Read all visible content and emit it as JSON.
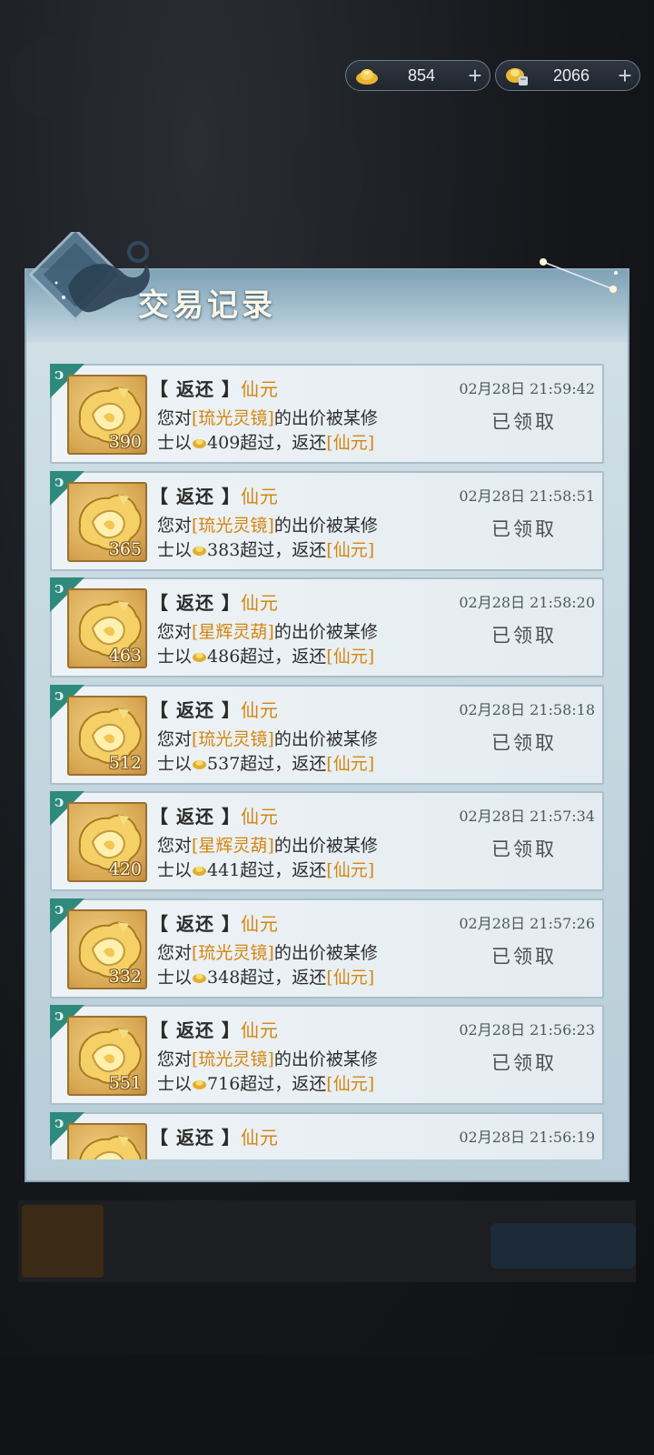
{
  "currency": [
    {
      "icon": "gold-ingot-icon",
      "value": "854"
    },
    {
      "icon": "gold-pouch-icon",
      "value": "2066"
    }
  ],
  "panel": {
    "title": "交易记录"
  },
  "records": [
    {
      "qty": "390",
      "tag": "【 返还 】",
      "currency_name": "仙元",
      "time": "02月28日  21:59:42",
      "line1_prefix": "您对",
      "item": "[琉光灵镜]",
      "line1_suffix": "的出价被某修",
      "line2_prefix": "士以",
      "bid": "409",
      "line2_mid": "超过，返还",
      "refund": "[仙元]",
      "status": "已领取"
    },
    {
      "qty": "365",
      "tag": "【 返还 】",
      "currency_name": "仙元",
      "time": "02月28日  21:58:51",
      "line1_prefix": "您对",
      "item": "[琉光灵镜]",
      "line1_suffix": "的出价被某修",
      "line2_prefix": "士以",
      "bid": "383",
      "line2_mid": "超过，返还",
      "refund": "[仙元]",
      "status": "已领取"
    },
    {
      "qty": "463",
      "tag": "【 返还 】",
      "currency_name": "仙元",
      "time": "02月28日  21:58:20",
      "line1_prefix": "您对",
      "item": "[星辉灵葫]",
      "line1_suffix": "的出价被某修",
      "line2_prefix": "士以",
      "bid": "486",
      "line2_mid": "超过，返还",
      "refund": "[仙元]",
      "status": "已领取"
    },
    {
      "qty": "512",
      "tag": "【 返还 】",
      "currency_name": "仙元",
      "time": "02月28日  21:58:18",
      "line1_prefix": "您对",
      "item": "[琉光灵镜]",
      "line1_suffix": "的出价被某修",
      "line2_prefix": "士以",
      "bid": "537",
      "line2_mid": "超过，返还",
      "refund": "[仙元]",
      "status": "已领取"
    },
    {
      "qty": "420",
      "tag": "【 返还 】",
      "currency_name": "仙元",
      "time": "02月28日  21:57:34",
      "line1_prefix": "您对",
      "item": "[星辉灵葫]",
      "line1_suffix": "的出价被某修",
      "line2_prefix": "士以",
      "bid": "441",
      "line2_mid": "超过，返还",
      "refund": "[仙元]",
      "status": "已领取"
    },
    {
      "qty": "332",
      "tag": "【 返还 】",
      "currency_name": "仙元",
      "time": "02月28日  21:57:26",
      "line1_prefix": "您对",
      "item": "[琉光灵镜]",
      "line1_suffix": "的出价被某修",
      "line2_prefix": "士以",
      "bid": "348",
      "line2_mid": "超过，返还",
      "refund": "[仙元]",
      "status": "已领取"
    },
    {
      "qty": "551",
      "tag": "【 返还 】",
      "currency_name": "仙元",
      "time": "02月28日  21:56:23",
      "line1_prefix": "您对",
      "item": "[琉光灵镜]",
      "line1_suffix": "的出价被某修",
      "line2_prefix": "士以",
      "bid": "716",
      "line2_mid": "超过，返还",
      "refund": "[仙元]",
      "status": "已领取"
    },
    {
      "qty": "",
      "tag": "【 返还 】",
      "currency_name": "仙元",
      "time": "02月28日  21:56:19",
      "line1_prefix": "",
      "item": "",
      "line1_suffix": "",
      "line2_prefix": "",
      "bid": "",
      "line2_mid": "",
      "refund": "",
      "status": ""
    }
  ]
}
